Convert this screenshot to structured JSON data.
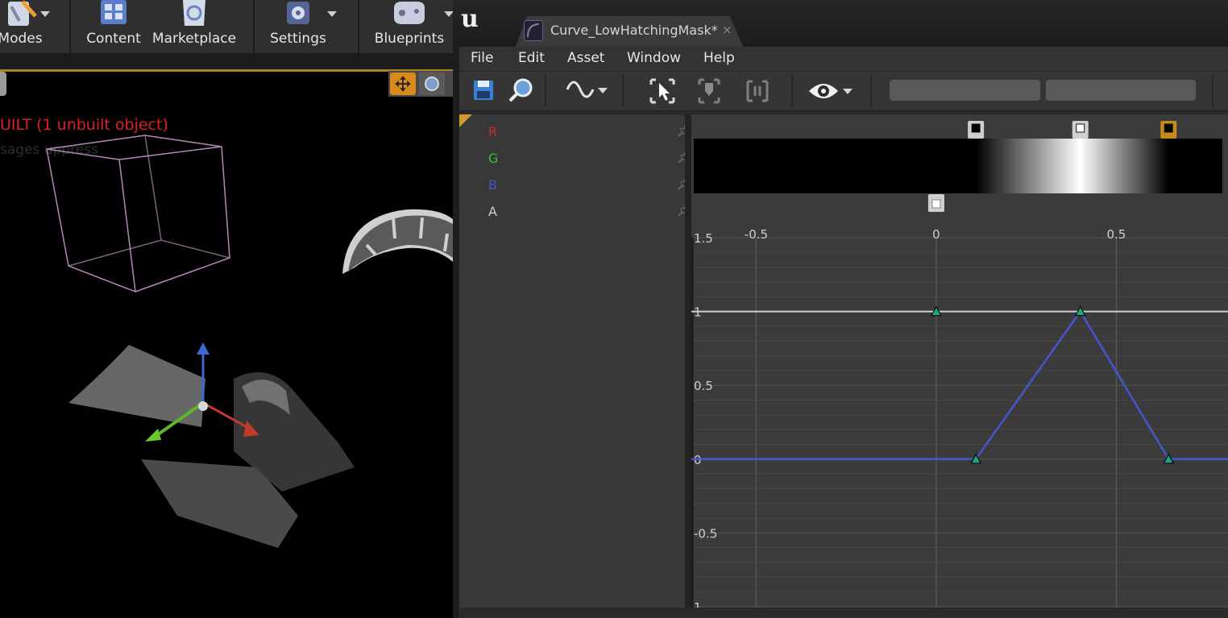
{
  "level_editor": {
    "toolbar": {
      "items": [
        {
          "label": "Modes",
          "icon": "modes-icon"
        },
        {
          "label": "Content",
          "icon": "content-browser-icon"
        },
        {
          "label": "Marketplace",
          "icon": "marketplace-icon"
        },
        {
          "label": "Settings",
          "icon": "settings-icon"
        },
        {
          "label": "Blueprints",
          "icon": "blueprints-icon"
        }
      ]
    },
    "viewport": {
      "status_text": "UILT (1 unbuilt object)",
      "status_color": "#e02020",
      "messages_text": "sages  uppress"
    }
  },
  "curve_editor": {
    "tab": {
      "title": "Curve_LowHatchingMask*",
      "close": "×"
    },
    "menu": [
      "File",
      "Edit",
      "Asset",
      "Window",
      "Help"
    ],
    "toolbar": {
      "icons": [
        "save-icon",
        "browse-icon",
        "curve-mode-icon",
        "select-icon",
        "key-tangent-icon",
        "frame-icon",
        "visibility-icon"
      ],
      "search_placeholder_1": "",
      "search_placeholder_2": ""
    },
    "channels": [
      {
        "name": "R",
        "color": "#cc2a2a"
      },
      {
        "name": "G",
        "color": "#2fc42f"
      },
      {
        "name": "B",
        "color": "#4656cc"
      },
      {
        "name": "A",
        "color": "#cfcfcf"
      }
    ],
    "gradient_stops": [
      {
        "time": 0.11,
        "value": 0,
        "kind": "color"
      },
      {
        "time": 0.4,
        "value": 1,
        "kind": "color"
      },
      {
        "time": 0.645,
        "value": 0,
        "kind": "color",
        "selected": true
      },
      {
        "time": 0.0,
        "value": 1,
        "kind": "alpha"
      }
    ],
    "accent_color": "#c48a1e"
  },
  "chart_data": {
    "type": "line",
    "title": "",
    "xlabel": "",
    "ylabel": "",
    "xlim": [
      -0.68,
      0.81
    ],
    "ylim": [
      -1.0,
      1.5
    ],
    "x_ticks": [
      -0.5,
      0,
      0.5
    ],
    "x_tick_labels": [
      "-0.5",
      "0",
      "0.5"
    ],
    "y_ticks": [
      1.5,
      1,
      0.5,
      0,
      -0.5,
      -1
    ],
    "y_tick_labels": [
      "1.5",
      "1",
      "0.5",
      "0",
      "-0.5",
      "1"
    ],
    "grid": true,
    "series": [
      {
        "color": "#4656cc",
        "points": [
          [
            -0.68,
            0
          ],
          [
            0.11,
            0
          ],
          [
            0.4,
            1
          ],
          [
            0.645,
            0
          ],
          [
            0.81,
            0
          ]
        ],
        "keys": [
          [
            0.11,
            0
          ],
          [
            0.4,
            1
          ],
          [
            0.645,
            0
          ]
        ]
      },
      {
        "color": "#cfcfcf",
        "points": [
          [
            -0.68,
            1
          ],
          [
            0.81,
            1
          ]
        ],
        "keys": [
          [
            0.0,
            1
          ]
        ]
      }
    ]
  }
}
